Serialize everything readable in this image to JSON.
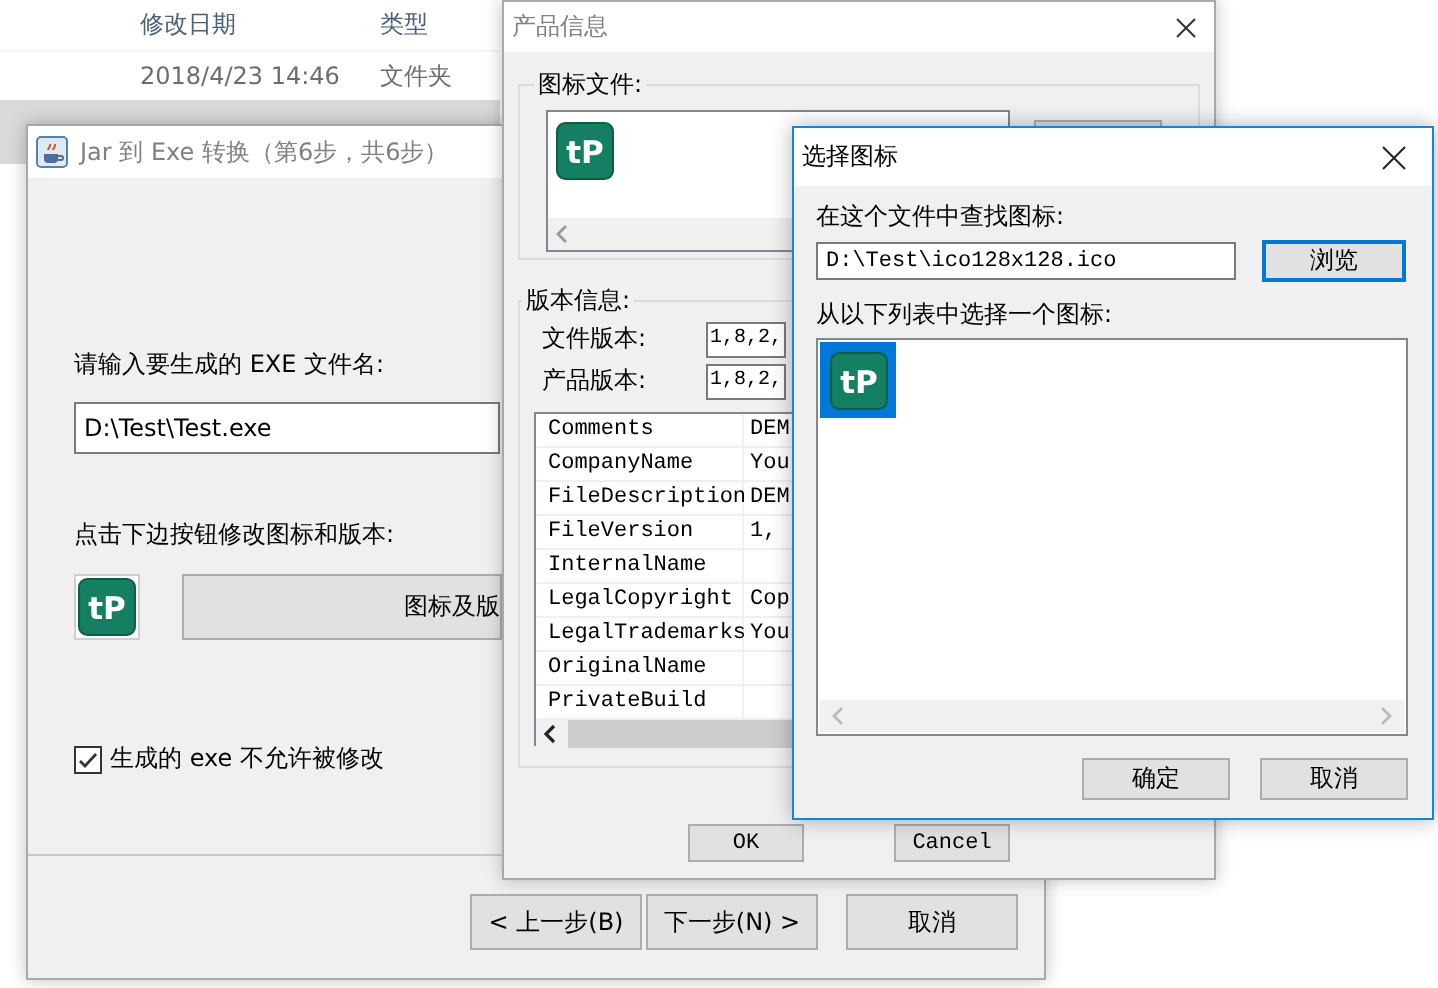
{
  "explorer": {
    "columns": [
      "修改日期",
      "类型"
    ],
    "rows": [
      {
        "cells": [
          "2018/4/23 14:46",
          "文件夹"
        ],
        "selected": false
      },
      {
        "selected": true
      }
    ]
  },
  "wizard": {
    "title": "Jar 到 Exe 转换（第6步，共6步）",
    "filename_label": "请输入要生成的 EXE 文件名:",
    "filename": "D:\\Test\\Test.exe",
    "icon_label": "点击下边按钮修改图标和版本:",
    "icon_text": "tP",
    "icon_button": "图标及版",
    "lock_checkbox": {
      "label": "生成的 exe 不允许被修改",
      "checked": true
    },
    "buttons": [
      "< 上一步(B)",
      "下一步(N) >",
      "取消"
    ]
  },
  "product_info": {
    "title": "产品信息",
    "icon_group": {
      "legend": "图标文件:",
      "icon_text": "tP"
    },
    "version_group": {
      "legend": "版本信息:",
      "file_version_label": "文件版本:",
      "file_version": "1,8,2,",
      "product_version_label": "产品版本:",
      "product_version": "1,8,2,"
    },
    "properties": [
      {
        "name": "Comments",
        "value": "DEM"
      },
      {
        "name": "CompanyName",
        "value": "You"
      },
      {
        "name": "FileDescription",
        "value": "DEM"
      },
      {
        "name": "FileVersion",
        "value": "1,"
      },
      {
        "name": "InternalName"
      },
      {
        "name": "LegalCopyright",
        "value": "Cop"
      },
      {
        "name": "LegalTrademarks",
        "value": "You"
      },
      {
        "name": "OriginalName"
      },
      {
        "name": "PrivateBuild"
      }
    ],
    "buttons": [
      "OK",
      "Cancel"
    ]
  },
  "choose_icon": {
    "title": "选择图标",
    "search_label": "在这个文件中查找图标:",
    "path": "D:\\Test\\ico128x128.ico",
    "browse_button": "浏览",
    "list_label": "从以下列表中选择一个图标:",
    "icons": [
      {
        "icon_text": "tP",
        "selected": true
      }
    ],
    "buttons": [
      "确定",
      "取消"
    ]
  }
}
